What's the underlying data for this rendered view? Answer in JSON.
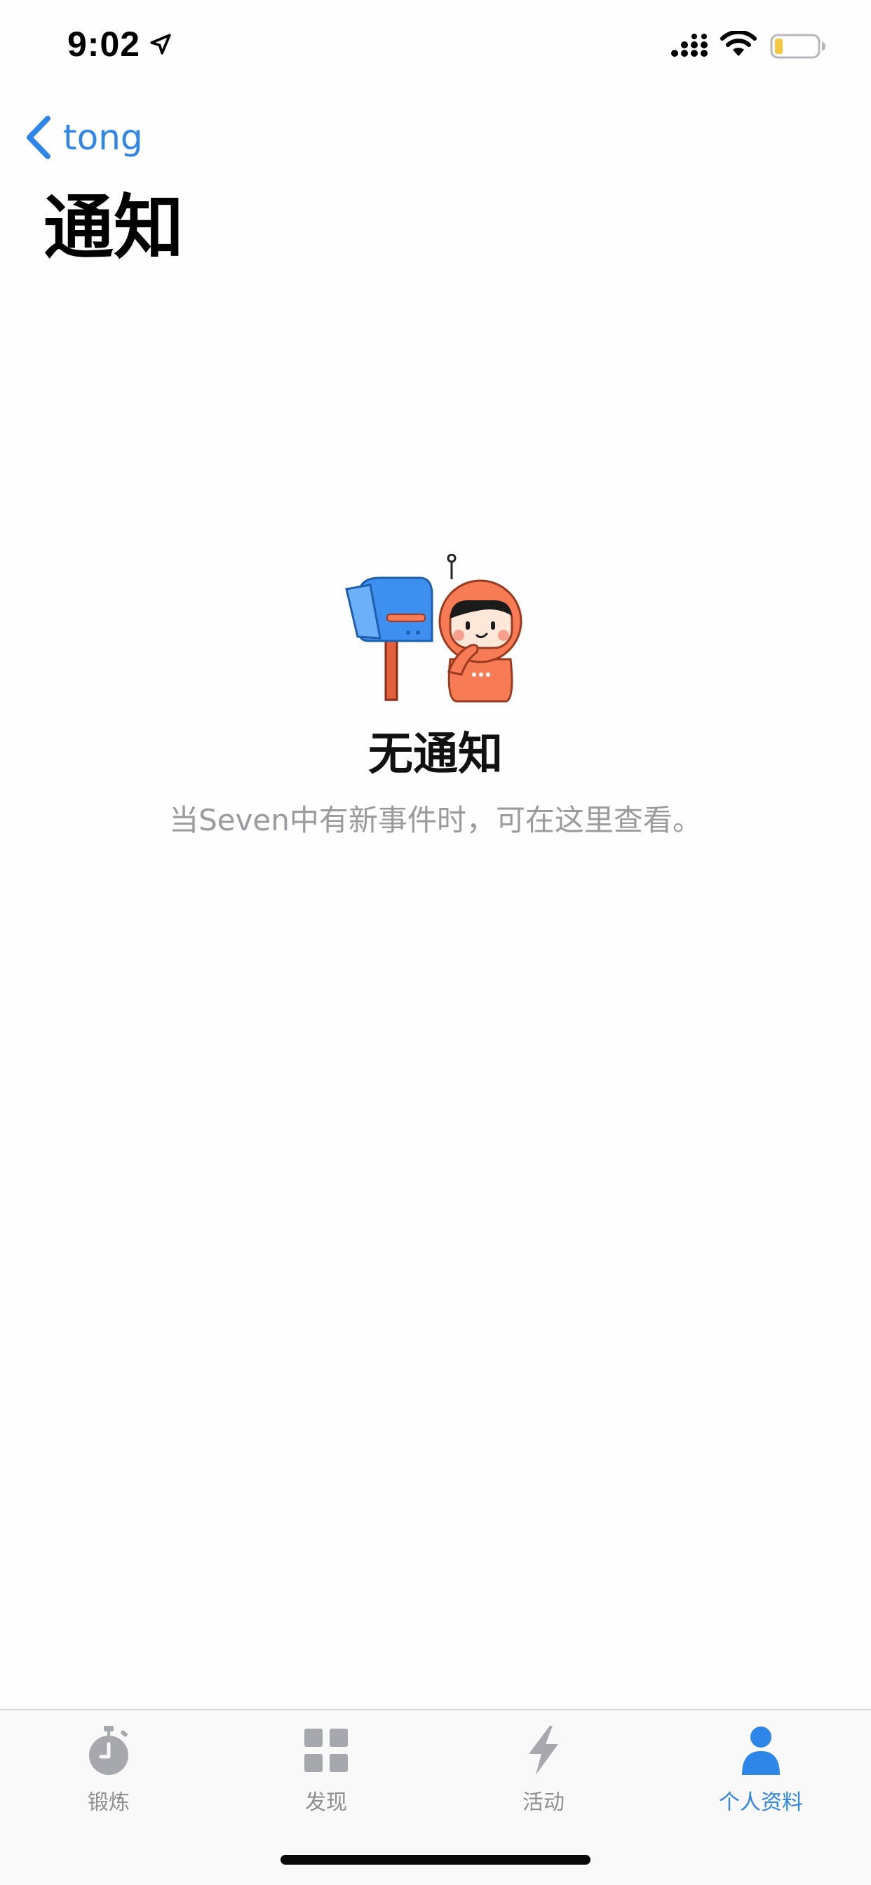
{
  "status_bar": {
    "time": "9:02",
    "icons": [
      "location-arrow-icon",
      "cellular-signal-icon",
      "wifi-icon",
      "battery-icon"
    ]
  },
  "nav": {
    "back_label": "tong",
    "back_icon": "chevron-left-icon",
    "title": "通知"
  },
  "empty_state": {
    "illustration": "mailbox-with-astronaut",
    "title": "无通知",
    "description": "当Seven中有新事件时，可在这里查看。"
  },
  "tabs": [
    {
      "label": "锻炼",
      "icon": "stopwatch-icon",
      "active": false
    },
    {
      "label": "发现",
      "icon": "grid-icon",
      "active": false
    },
    {
      "label": "活动",
      "icon": "lightning-icon",
      "active": false
    },
    {
      "label": "个人资料",
      "icon": "person-icon",
      "active": true
    }
  ],
  "colors": {
    "accent": "#2f86e9",
    "inactive_tab": "#a6a8ae",
    "secondary_text": "#9a9a9f",
    "mascot_orange": "#f77b55",
    "mailbox_blue": "#3d8ff0",
    "battery_low": "#f6c945"
  }
}
